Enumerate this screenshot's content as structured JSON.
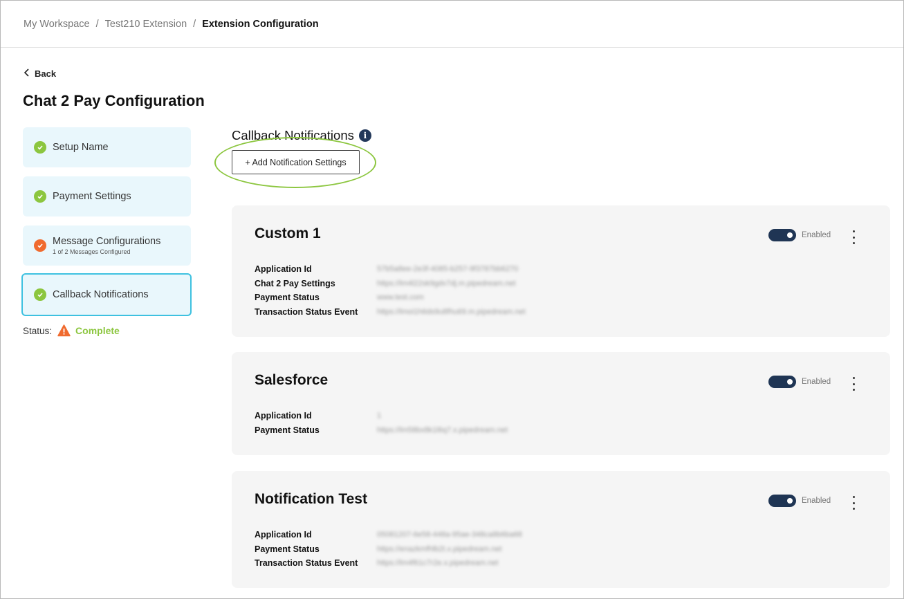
{
  "breadcrumb": {
    "items": [
      "My Workspace",
      "Test210 Extension",
      "Extension Configuration"
    ],
    "separator": "/"
  },
  "back_label": "Back",
  "page_title": "Chat 2 Pay Configuration",
  "steps": [
    {
      "label": "Setup Name",
      "state": "done",
      "sub": ""
    },
    {
      "label": "Payment Settings",
      "state": "done",
      "sub": ""
    },
    {
      "label": "Message Configurations",
      "state": "partial",
      "sub": "1 of 2 Messages Configured"
    },
    {
      "label": "Callback Notifications",
      "state": "done",
      "sub": "",
      "active": true
    }
  ],
  "status": {
    "label": "Status:",
    "value": "Complete"
  },
  "section": {
    "title": "Callback Notifications",
    "info_icon": "info-icon",
    "add_button": "+ Add Notification Settings"
  },
  "cards": [
    {
      "title": "Custom 1",
      "toggle_label": "Enabled",
      "fields": [
        {
          "label": "Application Id",
          "value": "57b5a8ee-2e3f-4085-b257-9f3787bb6270"
        },
        {
          "label": "Chat 2 Pay Settings",
          "value": "https://lm4l22sk9gdv7dj.m.pipedream.net"
        },
        {
          "label": "Payment Status",
          "value": "www.test.com"
        },
        {
          "label": "Transaction Status Event",
          "value": "https://lmoi1h6ds9u8fhu69.m.pipedream.net"
        }
      ]
    },
    {
      "title": "Salesforce",
      "toggle_label": "Enabled",
      "fields": [
        {
          "label": "Application Id",
          "value": "1"
        },
        {
          "label": "Payment Status",
          "value": "https://lm58bx8k1l6q7.x.pipedream.net"
        }
      ]
    },
    {
      "title": "Notification Test",
      "toggle_label": "Enabled",
      "fields": [
        {
          "label": "Application Id",
          "value": "05081207-6e58-448a-95ae-348ca8b6ba68"
        },
        {
          "label": "Payment Status",
          "value": "https://enazkmfhlb2t.x.pipedream.net"
        },
        {
          "label": "Transaction Status Event",
          "value": "https://lm4f61c7r2e.x.pipedream.net"
        }
      ]
    }
  ],
  "colors": {
    "accent_green": "#8cc63f",
    "warning_orange": "#f06b2f",
    "active_border": "#3ec1e0",
    "toggle_navy": "#1f3554"
  }
}
